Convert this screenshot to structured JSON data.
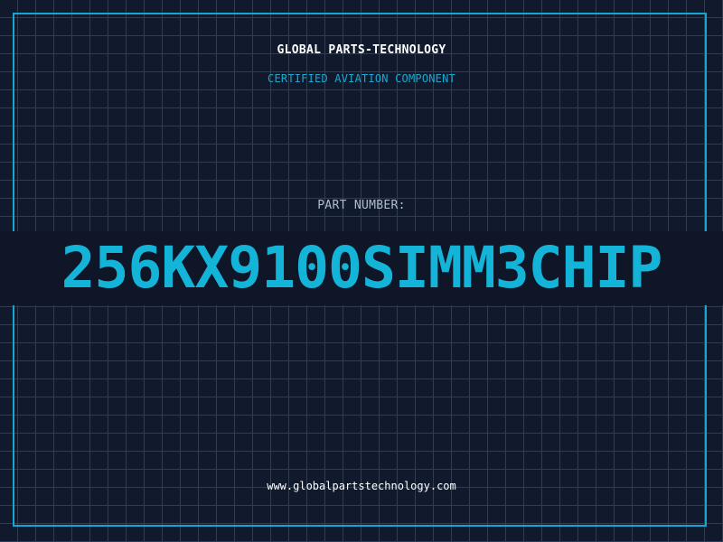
{
  "header": {
    "company": "GLOBAL PARTS-TECHNOLOGY",
    "subtitle": "CERTIFIED AVIATION COMPONENT"
  },
  "part": {
    "label": "PART NUMBER:",
    "number": "256KX9100SIMM3CHIP"
  },
  "footer": {
    "url": "www.globalpartstechnology.com"
  },
  "colors": {
    "background": "#111a2c",
    "grid": "#23415a",
    "accent": "#14b4d8",
    "label": "#aebed0",
    "text": "#ffffff"
  }
}
